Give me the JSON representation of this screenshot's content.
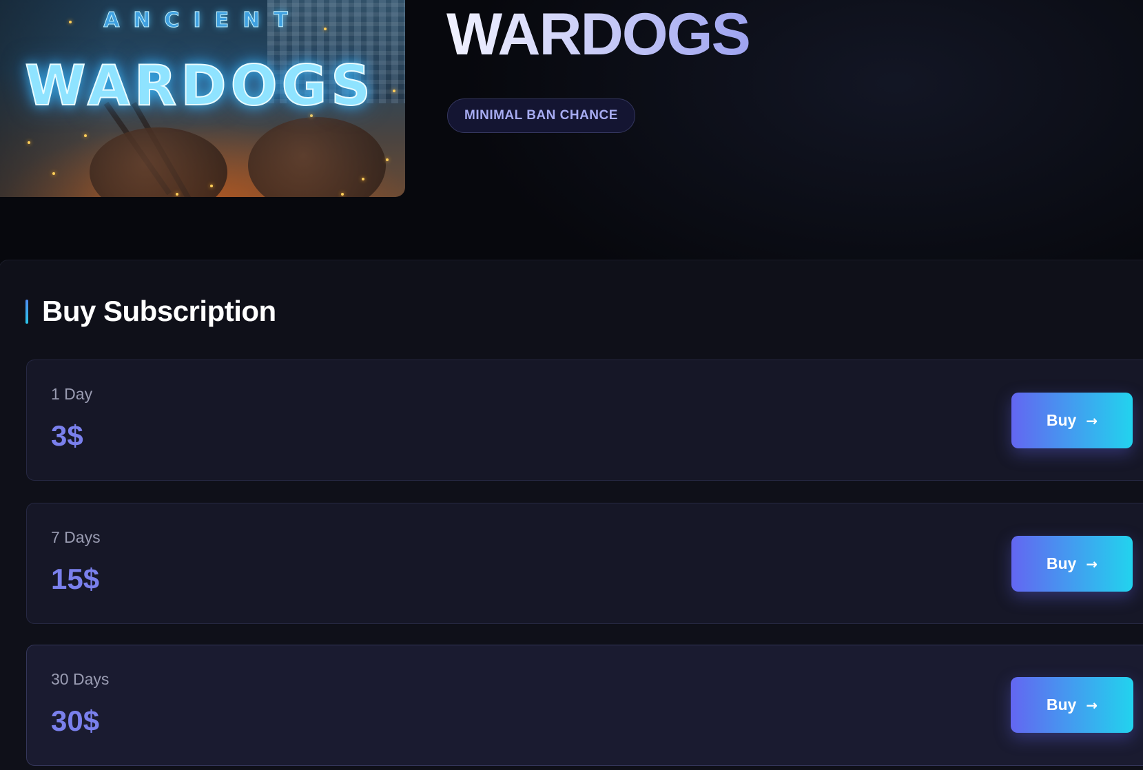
{
  "cover": {
    "subtitle": "ANCIENT",
    "title": "WARDOGS"
  },
  "product": {
    "title": "WARDOGS",
    "badge": "MINIMAL BAN CHANCE"
  },
  "subscription": {
    "heading": "Buy Subscription",
    "plans": [
      {
        "duration": "1 Day",
        "price": "3$",
        "button_label": "Buy"
      },
      {
        "duration": "7 Days",
        "price": "15$",
        "button_label": "Buy"
      },
      {
        "duration": "30 Days",
        "price": "30$",
        "button_label": "Buy"
      }
    ]
  },
  "colors": {
    "background": "#07080d",
    "accent_price": "#7a80ec",
    "button_gradient_start": "#6366f1",
    "button_gradient_end": "#22d3ee",
    "badge_text": "#a7acf2"
  },
  "icons": {
    "buy_arrow": "arrow-right-icon"
  }
}
